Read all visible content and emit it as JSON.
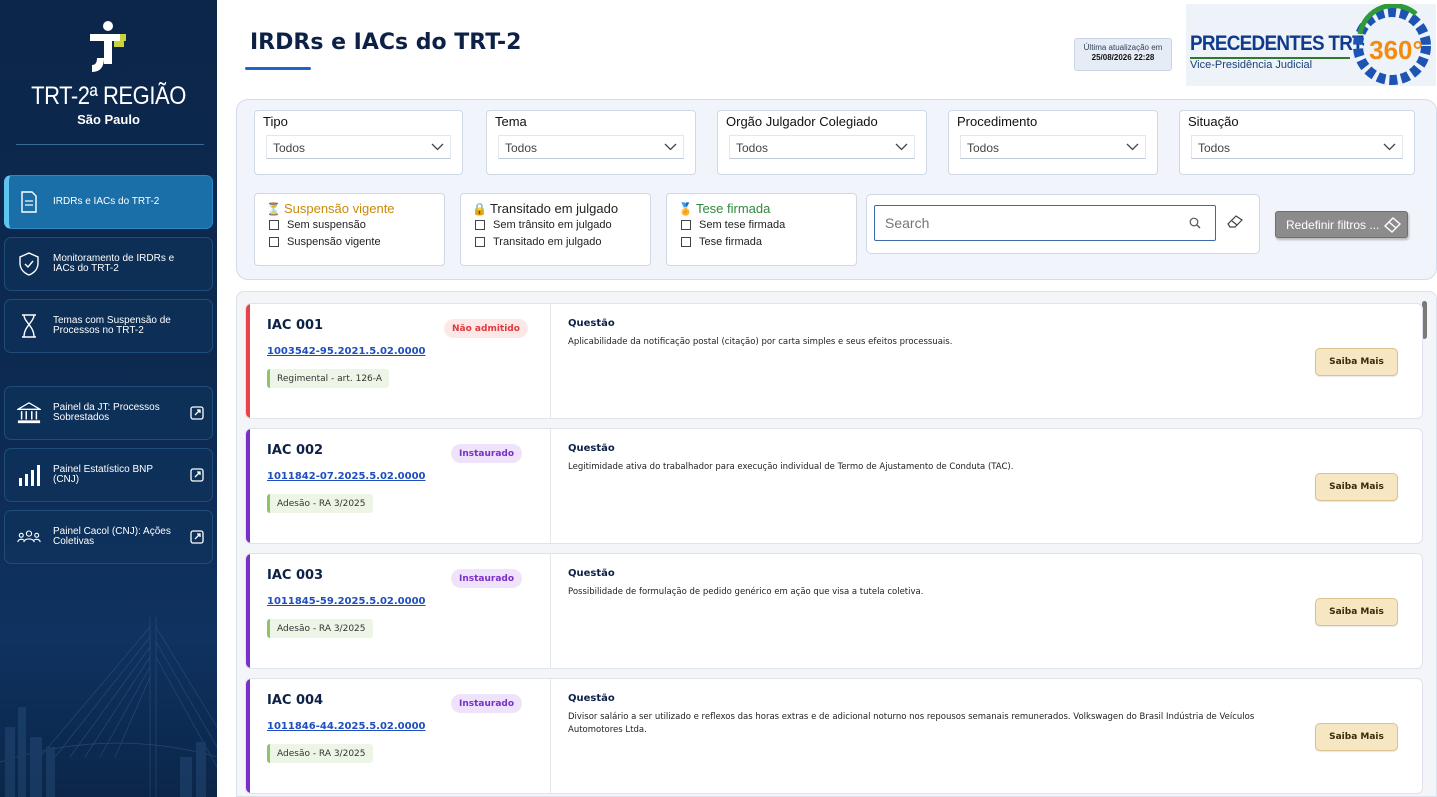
{
  "sidebar": {
    "logo_title": "TRT-2ª REGIÃO",
    "logo_sub": "São Paulo",
    "items": [
      {
        "label": "IRDRs e IACs do TRT-2",
        "icon": "document-icon",
        "active": true
      },
      {
        "label": "Monitoramento de IRDRs e IACs do TRT-2",
        "icon": "shield-check-icon",
        "active": false
      },
      {
        "label": "Temas com Suspensão de Processos no TRT-2",
        "icon": "hourglass-icon",
        "active": false
      },
      {
        "label": "Painel da JT: Processos Sobrestados",
        "icon": "courthouse-icon",
        "external": true
      },
      {
        "label": "Painel Estatístico BNP (CNJ)",
        "icon": "bar-chart-icon",
        "external": true
      },
      {
        "label": "Painel Cacol (CNJ): Ações Coletivas",
        "icon": "people-group-icon",
        "external": true
      }
    ]
  },
  "header": {
    "title": "IRDRs e IACs do TRT-2",
    "update_label": "Última atualização em",
    "update_value": "25/08/2026 22:28",
    "brand_title": "PRECEDENTES TRT-2",
    "brand_360": "360°",
    "brand_sub": "Vice-Presidência Judicial"
  },
  "filters": {
    "dropdowns": [
      {
        "label": "Tipo",
        "value": "Todos"
      },
      {
        "label": "Tema",
        "value": "Todos"
      },
      {
        "label": "Orgão Julgador Colegiado",
        "value": "Todos"
      },
      {
        "label": "Procedimento",
        "value": "Todos"
      },
      {
        "label": "Situação",
        "value": "Todos"
      }
    ],
    "checkgroups": [
      {
        "title": "Suspensão vigente",
        "emoji": "⏳",
        "color": "#c98a0a",
        "options": [
          "Sem suspensão",
          "Suspensão vigente"
        ]
      },
      {
        "title": "Transitado em julgado",
        "emoji": "🔒",
        "color": "#222222",
        "options": [
          "Sem trânsito em julgado",
          "Transitado em julgado"
        ]
      },
      {
        "title": "Tese firmada",
        "emoji": "🏅",
        "color": "#2e8b3a",
        "options": [
          "Sem tese firmada",
          "Tese firmada"
        ]
      }
    ],
    "search_placeholder": "Search",
    "reset_label": "Redefinir filtros ..."
  },
  "cards": [
    {
      "id": "IAC 001",
      "status": "Não admitido",
      "status_color": "#e0383b",
      "status_bg": "#fde8e8",
      "accent": "#e8434a",
      "process": "1003542-95.2021.5.02.0000",
      "tag": "Regimental - art. 126-A",
      "question_label": "Questão",
      "question": "Aplicabilidade da notificação postal (citação) por carta simples e seus efeitos processuais.",
      "button": "Saiba Mais"
    },
    {
      "id": "IAC 002",
      "status": "Instaurado",
      "status_color": "#7a2fc8",
      "status_bg": "#efe3fb",
      "accent": "#7a2fc8",
      "process": "1011842-07.2025.5.02.0000",
      "tag": "Adesão - RA 3/2025",
      "question_label": "Questão",
      "question": "Legitimidade ativa do trabalhador para execução individual de Termo de Ajustamento de Conduta (TAC).",
      "button": "Saiba Mais"
    },
    {
      "id": "IAC 003",
      "status": "Instaurado",
      "status_color": "#7a2fc8",
      "status_bg": "#efe3fb",
      "accent": "#7a2fc8",
      "process": "1011845-59.2025.5.02.0000",
      "tag": "Adesão - RA 3/2025",
      "question_label": "Questão",
      "question": "Possibilidade de formulação de pedido genérico em ação que visa a tutela coletiva.",
      "button": "Saiba Mais"
    },
    {
      "id": "IAC 004",
      "status": "Instaurado",
      "status_color": "#7a2fc8",
      "status_bg": "#efe3fb",
      "accent": "#7a2fc8",
      "process": "1011846-44.2025.5.02.0000",
      "tag": "Adesão - RA 3/2025",
      "question_label": "Questão",
      "question": "Divisor salário a ser utilizado e reflexos das horas extras e de adicional noturno nos repousos semanais remunerados. Volkswagen do Brasil Indústria de Veículos Automotores Ltda.",
      "button": "Saiba Mais"
    }
  ]
}
